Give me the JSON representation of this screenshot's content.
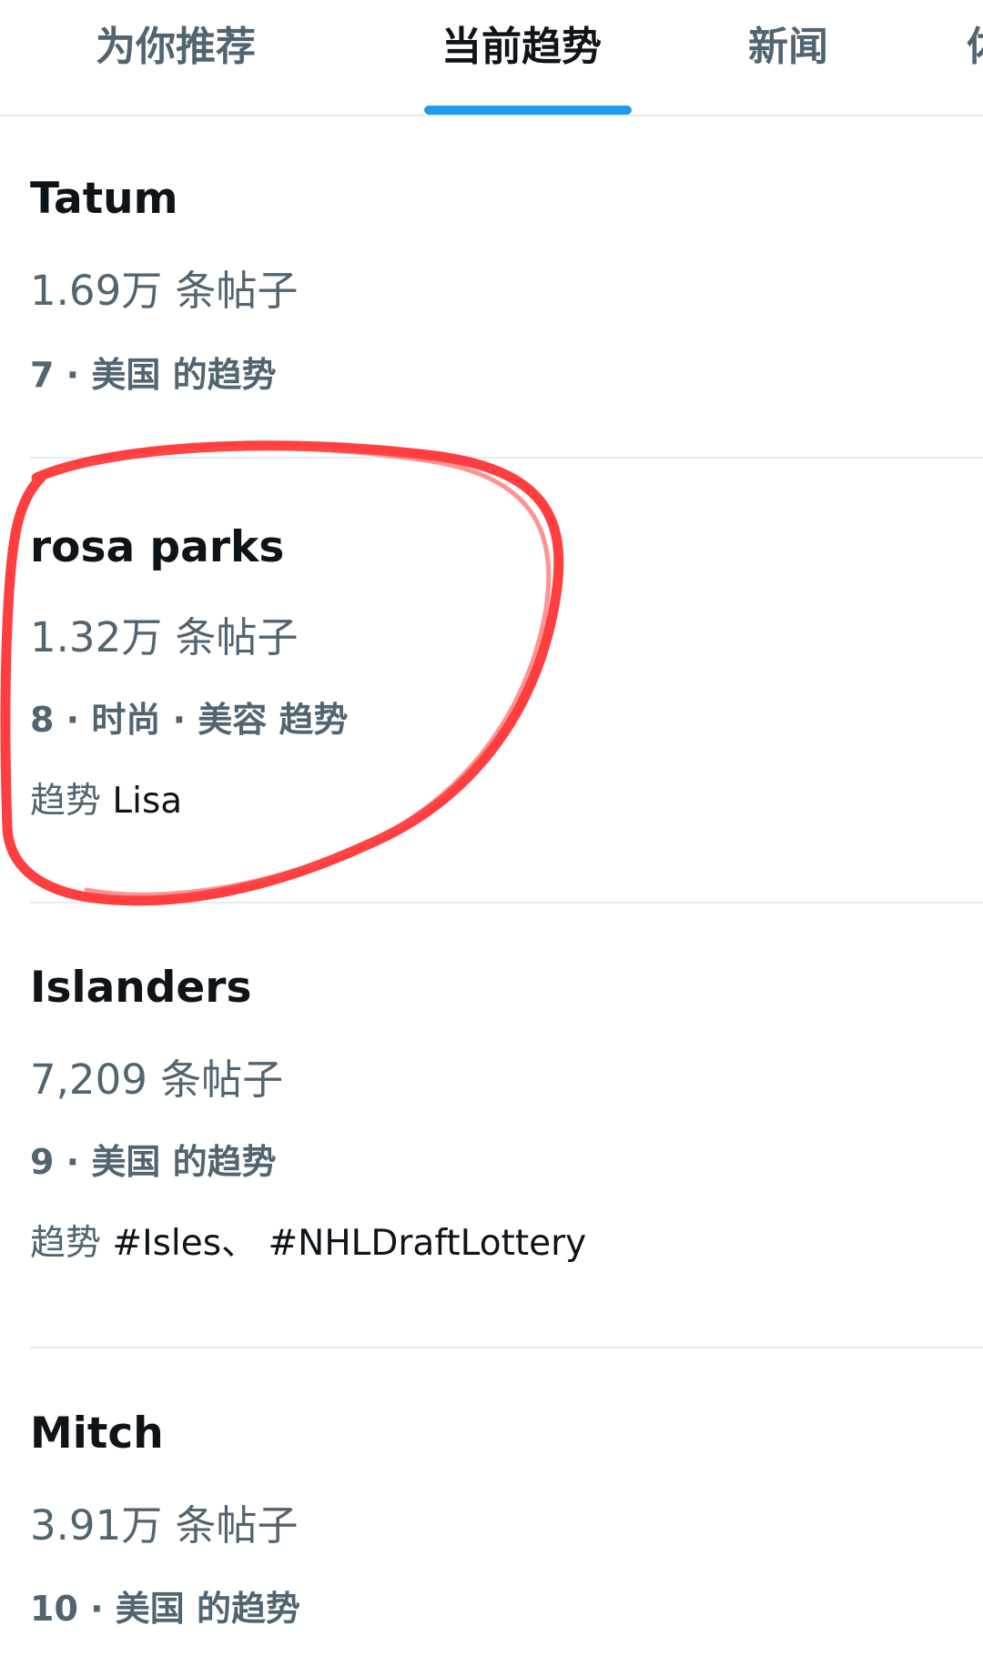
{
  "tabs": [
    {
      "label": "为你推荐",
      "active": false
    },
    {
      "label": "当前趋势",
      "active": true
    },
    {
      "label": "新闻",
      "active": false
    },
    {
      "label": "体",
      "active": false
    }
  ],
  "accent_color": "#1d9bf0",
  "annotation_color": "#ff2a2a",
  "trends": [
    {
      "title": "Tatum",
      "count": "1.69万 条帖子",
      "rank": "7 · 美国 的趋势",
      "related_prefix": "",
      "related": ""
    },
    {
      "title": "rosa parks",
      "count": "1.32万 条帖子",
      "rank": "8 · 时尚 · 美容 趋势",
      "related_prefix": "趋势",
      "related": "Lisa"
    },
    {
      "title": "Islanders",
      "count": "7,209 条帖子",
      "rank": "9 · 美国 的趋势",
      "related_prefix": "趋势",
      "related": "#Isles、 #NHLDraftLottery"
    },
    {
      "title": "Mitch",
      "count": "3.91万 条帖子",
      "rank": "10 · 美国 的趋势",
      "related_prefix": "",
      "related": ""
    }
  ]
}
